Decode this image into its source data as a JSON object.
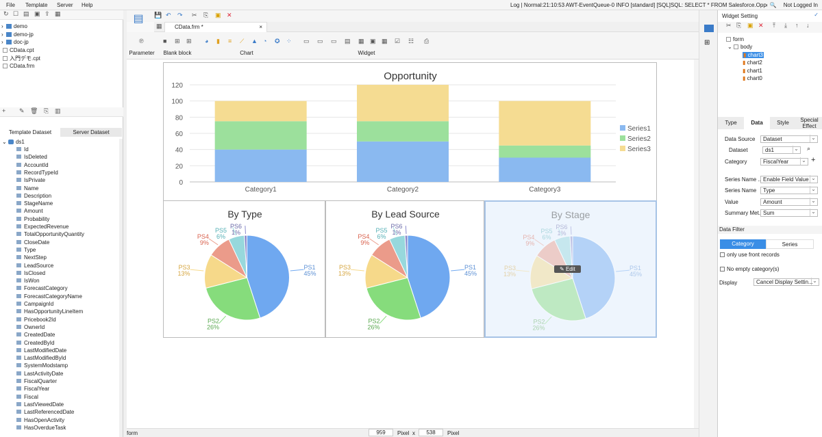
{
  "menu": {
    "file": "File",
    "template": "Template",
    "server": "Server",
    "help": "Help"
  },
  "log": "Log | Normal:21:10:53 AWT-EventQueue-0 INFO [standard] [SQL]SQL: SELECT * FROM Salesforce.Opportu...",
  "login": "Not Logged In",
  "files": [
    {
      "name": "demo",
      "type": "folder"
    },
    {
      "name": "demo-jp",
      "type": "folder"
    },
    {
      "name": "doc-jp",
      "type": "folder"
    },
    {
      "name": "CData.cpt",
      "type": "file"
    },
    {
      "name": "入門デモ.cpt",
      "type": "file"
    },
    {
      "name": "CData.frm",
      "type": "file"
    }
  ],
  "dataset_tabs": {
    "template": "Template Dataset",
    "server": "Server Dataset"
  },
  "dataset_name": "ds1",
  "fields": [
    "Id",
    "IsDeleted",
    "AccountId",
    "RecordTypeId",
    "IsPrivate",
    "Name",
    "Description",
    "StageName",
    "Amount",
    "Probability",
    "ExpectedRevenue",
    "TotalOpportunityQuantity",
    "CloseDate",
    "Type",
    "NextStep",
    "LeadSource",
    "IsClosed",
    "IsWon",
    "ForecastCategory",
    "ForecastCategoryName",
    "CampaignId",
    "HasOpportunityLineItem",
    "Pricebook2Id",
    "OwnerId",
    "CreatedDate",
    "CreatedById",
    "LastModifiedDate",
    "LastModifiedById",
    "SystemModstamp",
    "LastActivityDate",
    "FiscalQuarter",
    "FiscalYear",
    "Fiscal",
    "LastViewedDate",
    "LastReferencedDate",
    "HasOpenActivity",
    "HasOverdueTask"
  ],
  "doc_tab": "CData.frm *",
  "ribbon": {
    "parameter": "Parameter",
    "blank_block": "Blank block",
    "chart": "Chart",
    "widget": "Widget"
  },
  "bar_chart": {
    "title": "Opportunity",
    "categories": [
      "Category1",
      "Category2",
      "Category3"
    ],
    "ylim": [
      0,
      120
    ],
    "ticks": [
      "0",
      "20",
      "40",
      "60",
      "80",
      "100",
      "120"
    ],
    "series": [
      {
        "name": "Series1",
        "values": [
          40,
          50,
          30
        ],
        "color": "#8ab9f0"
      },
      {
        "name": "Series2",
        "values": [
          35,
          25,
          15
        ],
        "color": "#9ce09c"
      },
      {
        "name": "Series3",
        "values": [
          25,
          45,
          55
        ],
        "color": "#f5dc92"
      }
    ]
  },
  "chart_data": [
    {
      "type": "bar",
      "title": "Opportunity",
      "categories": [
        "Category1",
        "Category2",
        "Category3"
      ],
      "ylim": [
        0,
        120
      ],
      "series": [
        {
          "name": "Series1",
          "values": [
            40,
            50,
            30
          ]
        },
        {
          "name": "Series2",
          "values": [
            35,
            25,
            15
          ]
        },
        {
          "name": "Series3",
          "values": [
            25,
            45,
            55
          ]
        }
      ]
    },
    {
      "type": "pie",
      "title": "By Type",
      "labels": [
        "PS1",
        "PS2",
        "PS3",
        "PS4",
        "PS5",
        "PS6"
      ],
      "values": [
        45,
        26,
        13,
        9,
        6,
        1
      ]
    },
    {
      "type": "pie",
      "title": "By Lead Source",
      "labels": [
        "PS1",
        "PS2",
        "PS3",
        "PS4",
        "PS5",
        "PS6"
      ],
      "values": [
        45,
        26,
        13,
        9,
        6,
        1
      ]
    },
    {
      "type": "pie",
      "title": "By Stage",
      "labels": [
        "PS1",
        "PS2",
        "PS3",
        "PS4",
        "PS5",
        "PS6"
      ],
      "values": [
        45,
        26,
        13,
        9,
        6,
        1
      ]
    }
  ],
  "pies": [
    {
      "title": "By Type"
    },
    {
      "title": "By Lead Source"
    },
    {
      "title": "By Stage"
    }
  ],
  "pie_slices": [
    {
      "label": "PS1",
      "pct": "45%",
      "value": 45,
      "color": "#6fa8f0",
      "text": "#5b8fd4"
    },
    {
      "label": "PS2",
      "pct": "26%",
      "value": 26,
      "color": "#86dc7c",
      "text": "#5aa850"
    },
    {
      "label": "PS3",
      "pct": "13%",
      "value": 13,
      "color": "#f6d98a",
      "text": "#d6a640"
    },
    {
      "label": "PS4",
      "pct": "9%",
      "value": 9,
      "color": "#eb9b8a",
      "text": "#d9624e"
    },
    {
      "label": "PS5",
      "pct": "6%",
      "value": 6,
      "color": "#97d8dc",
      "text": "#55b0b6"
    },
    {
      "label": "PS6",
      "pct": "1%",
      "value": 1,
      "color": "#8a8acc",
      "text": "#6a6aa8"
    }
  ],
  "edit_label": "Edit",
  "status": {
    "mode": "form",
    "width": "959",
    "unit1": "Pixel",
    "x": "x",
    "height": "538",
    "unit2": "Pixel"
  },
  "right": {
    "title": "Widget Setting",
    "tree": {
      "form": "form",
      "body": "body",
      "charts": [
        "chart3",
        "chart2",
        "chart1",
        "chart0"
      ]
    },
    "tabs": {
      "type": "Type",
      "data": "Data",
      "style": "Style",
      "special": "Special Effect"
    },
    "props": [
      {
        "label": "Data Source",
        "value": "Dataset"
      },
      {
        "label": "Dataset",
        "value": "ds1"
      },
      {
        "label": "Category",
        "value": "FiscalYear"
      },
      {
        "label": "Series Name ...",
        "value": "Enable Field Value"
      },
      {
        "label": "Series Name",
        "value": "Type"
      },
      {
        "label": "Value",
        "value": "Amount"
      },
      {
        "label": "Summary Met...",
        "value": "Sum"
      }
    ],
    "data_filter": "Data Filter",
    "filter_tabs": {
      "category": "Category",
      "series": "Series"
    },
    "only_front": "only use front records",
    "no_empty": "No empty category(s)",
    "display_label": "Display",
    "display_value": "Cancel Display Settin..."
  }
}
